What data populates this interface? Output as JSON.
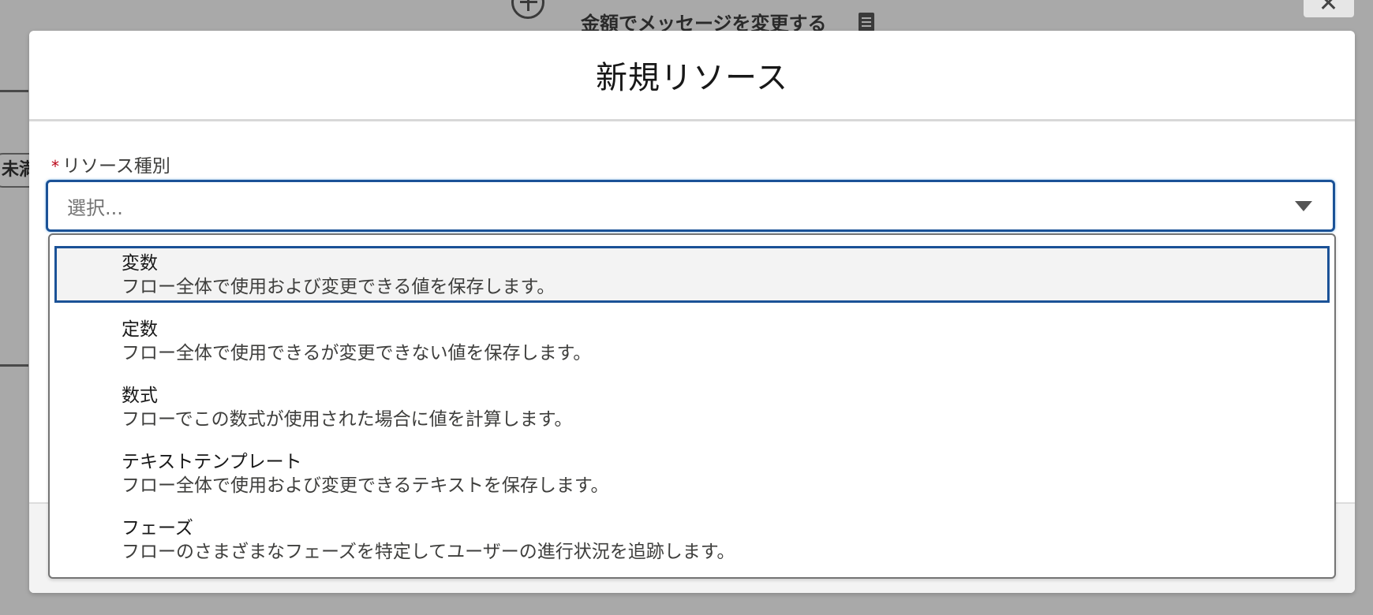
{
  "background": {
    "element_title": "金額でメッセージを変更する",
    "chip_label": "未満"
  },
  "modal": {
    "title": "新規リソース",
    "resource_type_field": {
      "required_mark": "*",
      "label": "リソース種別",
      "placeholder": "選択..."
    },
    "options": [
      {
        "title": "変数",
        "description": "フロー全体で使用および変更できる値を保存します。"
      },
      {
        "title": "定数",
        "description": "フロー全体で使用できるが変更できない値を保存します。"
      },
      {
        "title": "数式",
        "description": "フローでこの数式が使用された場合に値を計算します。"
      },
      {
        "title": "テキストテンプレート",
        "description": "フロー全体で使用および変更できるテキストを保存します。"
      },
      {
        "title": "フェーズ",
        "description": "フローのさまざまなフェーズを特定してユーザーの進行状況を追跡します。"
      }
    ]
  },
  "colors": {
    "focus_border": "#1b5297",
    "required": "#ba0517",
    "overlay": "#a9a9a9"
  }
}
